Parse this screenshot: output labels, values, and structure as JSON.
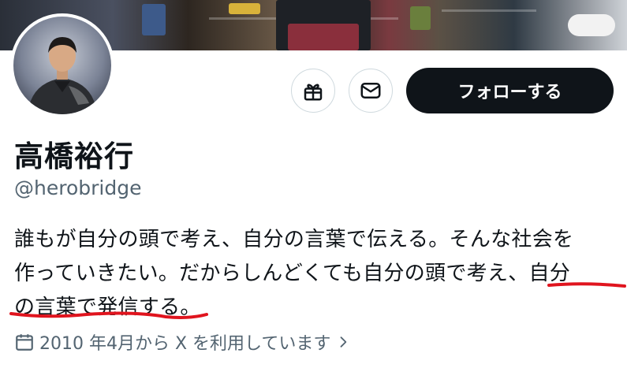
{
  "profile": {
    "name": "高橋裕行",
    "handle": "@herobridge",
    "bio_lines": [
      "誰もが自分の頭で考え、自分の言葉で伝える。そんな社会を",
      "作っていきたい。だからしんどくても自分の頭で考え、自分",
      "の言葉で発信する。"
    ],
    "joined": "2010 年4月から X を利用しています"
  },
  "actions": {
    "follow_label": "フォローする",
    "gift_icon": "gift-icon",
    "message_icon": "envelope-icon"
  },
  "colors": {
    "primary_text": "#0f1419",
    "secondary_text": "#536471",
    "button_bg": "#0f1419",
    "border": "#cfd9de",
    "annotation_red": "#e0141e"
  }
}
